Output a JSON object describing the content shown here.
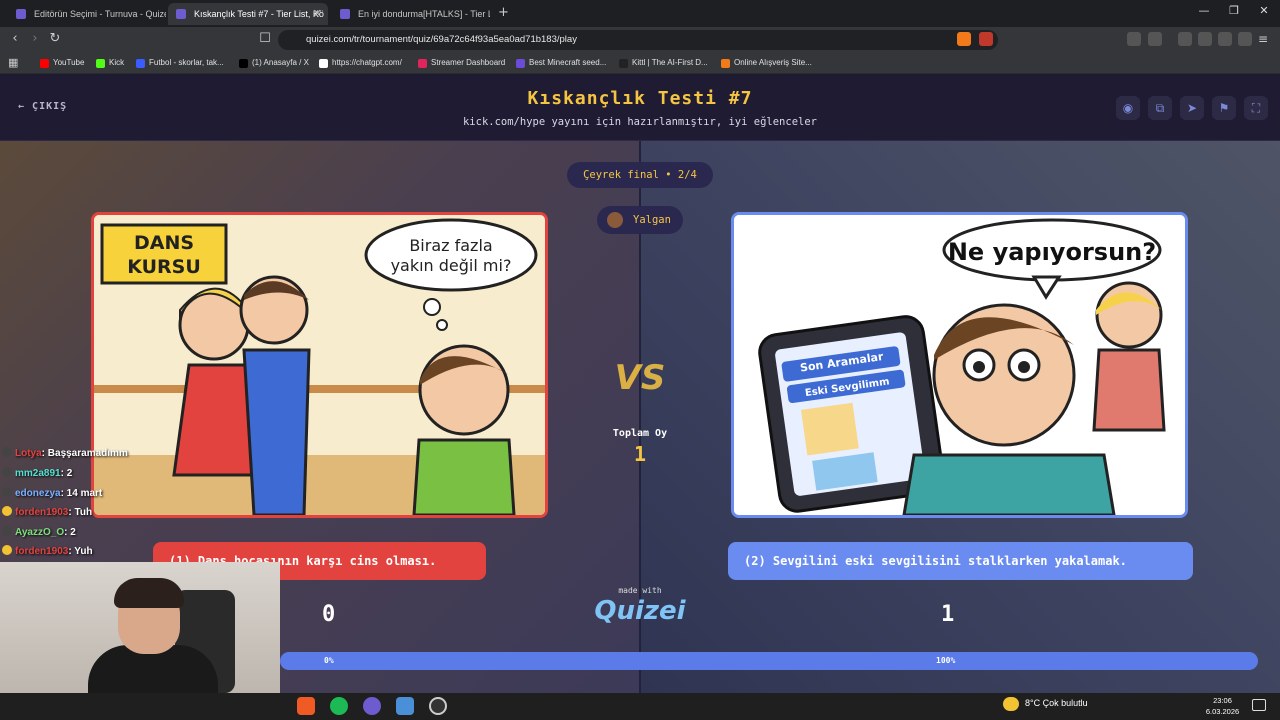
{
  "browser": {
    "tabs": [
      {
        "label": "Editörün Seçimi - Turnuva - Quizei",
        "active": false
      },
      {
        "label": "Kıskançlık Testi #7 - Tier List, Kö",
        "active": true
      },
      {
        "label": "En iyi dondurma[HTALKS] - Tier List |",
        "active": false
      }
    ],
    "url": "quizei.com/tr/tournament/quiz/69a72c64f93a5ea0ad71b183/play",
    "bookmarks": [
      {
        "label": "YouTube",
        "color": "#ff0000"
      },
      {
        "label": "Kick",
        "color": "#53fc18"
      },
      {
        "label": "Futbol - skorlar, tak...",
        "color": "#3b5cff"
      },
      {
        "label": "(1) Anasayfa / X",
        "color": "#000000"
      },
      {
        "label": "https://chatgpt.com/",
        "color": "#ffffff"
      },
      {
        "label": "Streamer Dashboard",
        "color": "#e0245e"
      },
      {
        "label": "Best Minecraft seed...",
        "color": "#6b4bd8"
      },
      {
        "label": "Kittl | The AI-First D...",
        "color": "#222222"
      },
      {
        "label": "Online Alışveriş Site...",
        "color": "#f27a1a"
      }
    ]
  },
  "app": {
    "exit_label": "ÇIKIŞ",
    "title": "Kıskançlık Testi #7",
    "subtitle": "kick.com/hype yayını için hazırlanmıştır, iyi eğlenceler",
    "round": "Çeyrek final • 2/4",
    "user": "Yalgan",
    "vs": "VS",
    "total_label": "Toplam Oy",
    "total_value": "1",
    "left": {
      "image_text_1": "DANS KURSU",
      "image_text_2": "Biraz fazla yakın değil mi?",
      "option": "(1) Dans hocasının karşı cins olması.",
      "score": "0",
      "percent": "0%"
    },
    "right": {
      "image_text_1": "Ne yapıyorsun?",
      "image_text_2": "Son Aramalar",
      "image_text_3": "Eski Sevgilimm",
      "option": "(2) Sevgilini eski sevgilisini stalklarken yakalamak.",
      "score": "1",
      "percent": "100%"
    },
    "progress_fraction": 1.0,
    "made_with": "made with",
    "logo": "Quizei",
    "accent_colors": {
      "left": "#e2433f",
      "right": "#6a8cf0",
      "title": "#f5c542"
    }
  },
  "chat": [
    {
      "user": "Lotya",
      "msg": ": Başşaramadımm",
      "color": "#e2433f"
    },
    {
      "user": "mm2a891",
      "msg": ": 2",
      "color": "#53e0d0"
    },
    {
      "user": "edonezya",
      "msg": ": 14 mart",
      "color": "#7ab0ff"
    },
    {
      "user": "forden1903",
      "msg": ": Tuh",
      "color": "#e2433f"
    },
    {
      "user": "AyazzO_O",
      "msg": ": 2",
      "color": "#7be07b"
    },
    {
      "user": "forden1903",
      "msg": ": Yuh",
      "color": "#e2433f"
    }
  ],
  "taskbar": {
    "weather": "8°C  Çok bulutlu",
    "time": "23:06",
    "date": "6.03.2026"
  }
}
